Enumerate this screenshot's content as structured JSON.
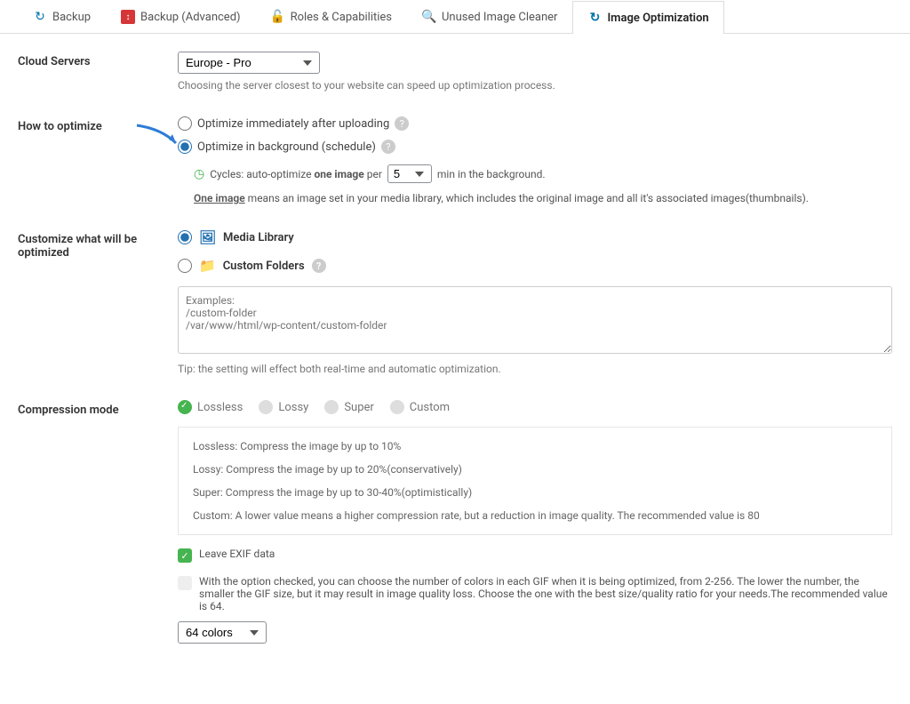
{
  "tabs": [
    {
      "label": "Backup",
      "icon": "↻",
      "iconClass": "ic-blue"
    },
    {
      "label": "Backup (Advanced)",
      "icon": "↕",
      "iconClass": "ic-red"
    },
    {
      "label": "Roles & Capabilities",
      "icon": "🔓",
      "iconClass": "ic-green"
    },
    {
      "label": "Unused Image Cleaner",
      "icon": "🔍",
      "iconClass": "ic-magnify"
    },
    {
      "label": "Image Optimization",
      "icon": "↻",
      "iconClass": "ic-blue",
      "active": true
    }
  ],
  "cloud": {
    "label": "Cloud Servers",
    "value": "Europe - Pro",
    "help": "Choosing the server closest to your website can speed up optimization process."
  },
  "howto": {
    "label": "How to optimize",
    "opt1": "Optimize immediately after uploading",
    "opt2": "Optimize in background (schedule)",
    "cycles_pre": "Cycles: auto-optimize ",
    "cycles_bold": "one image",
    "cycles_per": " per",
    "cycles_val": "5",
    "cycles_post": " min in the background.",
    "note_bold": "One image",
    "note_rest": " means an image set in your media library, which includes the original image and all it's associated images(thumbnails)."
  },
  "customize": {
    "label": "Customize what will be optimized",
    "media": "Media Library",
    "custom": "Custom Folders",
    "placeholder": "Examples:\n/custom-folder\n/var/www/html/wp-content/custom-folder",
    "tip": "Tip: the setting will effect both real-time and automatic optimization."
  },
  "mode": {
    "label": "Compression mode",
    "options": [
      "Lossless",
      "Lossy",
      "Super",
      "Custom"
    ],
    "desc1": "Lossless: Compress the image by up to 10%",
    "desc2": "Lossy: Compress the image by up to 20%(conservatively)",
    "desc3": "Super: Compress the image by up to 30-40%(optimistically)",
    "desc4": "Custom: A lower value means a higher compression rate, but a reduction in image quality. The recommended value is 80",
    "exif": "Leave EXIF data",
    "gif_desc": "With the option checked, you can choose the number of colors in each GIF when it is being optimized, from 2-256. The lower the number, the smaller the GIF size, but it may result in image quality loss. Choose the one with the best size/quality ratio for your needs.The recommended value is 64.",
    "gif_val": "64 colors"
  }
}
